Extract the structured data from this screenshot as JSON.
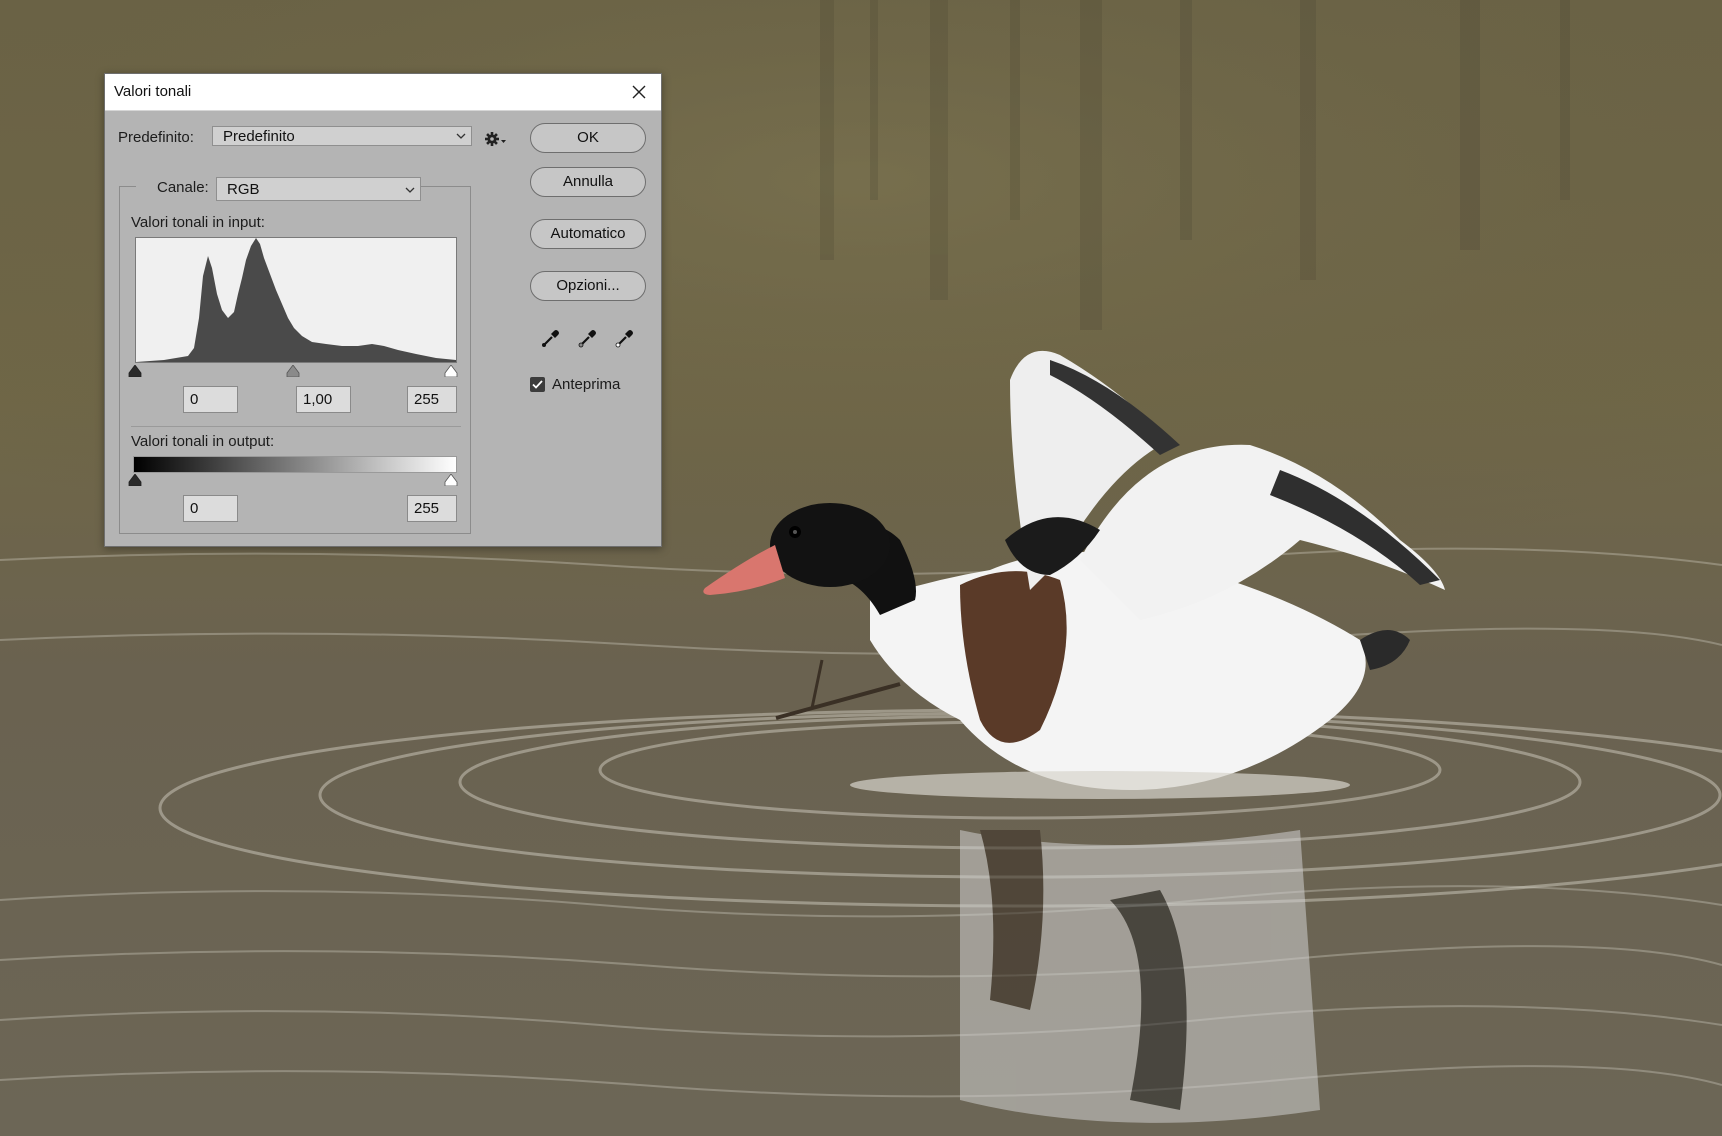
{
  "dialog": {
    "title": "Valori tonali",
    "preset_label": "Predefinito:",
    "preset_value": "Predefinito",
    "channel_label": "Canale:",
    "channel_value": "RGB",
    "input_section_label": "Valori tonali in input:",
    "input_black": "0",
    "input_gamma": "1,00",
    "input_white": "255",
    "output_section_label": "Valori tonali in output:",
    "output_black": "0",
    "output_white": "255",
    "buttons": {
      "ok": "OK",
      "cancel": "Annulla",
      "auto": "Automatico",
      "options": "Opzioni..."
    },
    "preview_label": "Anteprima",
    "preview_checked": true
  },
  "icons": [
    "close-icon",
    "chevron-down-icon",
    "gear-icon",
    "black-point-dropper-icon",
    "gray-point-dropper-icon",
    "white-point-dropper-icon",
    "checkbox-checked-icon"
  ],
  "colors": {
    "dialog_bg": "#b4b4b4",
    "histogram_fill": "#4a4a4a",
    "histogram_bg": "#f0f0f0",
    "water": "#6e6550"
  }
}
